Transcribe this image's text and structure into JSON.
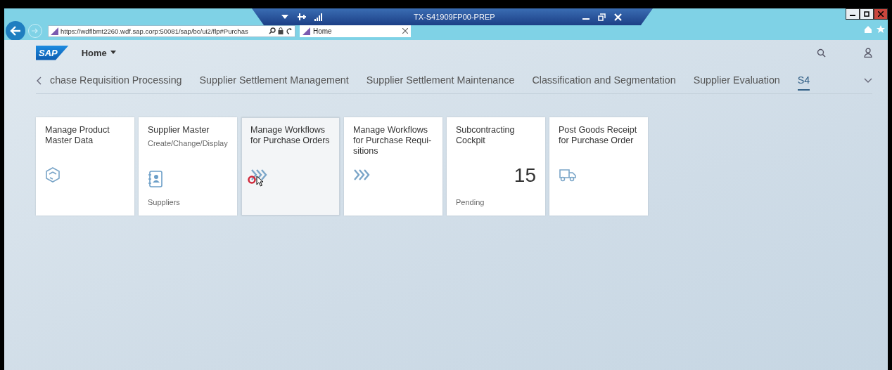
{
  "remote_bar": {
    "title": "TX-S41909FP00-PREP"
  },
  "browser": {
    "url": "https://wdflbmt2260.wdf.sap.corp:50081/sap/bc/ui2/flp#Purchas",
    "tab_title": "Home"
  },
  "shell": {
    "logo": "SAP",
    "title": "Home"
  },
  "groups": [
    {
      "label": "chase Requisition Processing",
      "selected": false
    },
    {
      "label": "Supplier Settlement Management",
      "selected": false
    },
    {
      "label": "Supplier Settlement Maintenance",
      "selected": false
    },
    {
      "label": "Classification and Segmentation",
      "selected": false
    },
    {
      "label": "Supplier Evaluation",
      "selected": false
    },
    {
      "label": "S4",
      "selected": true
    }
  ],
  "tiles": [
    {
      "kind": "icon",
      "title": "Manage Product Master Data",
      "hovered": false
    },
    {
      "kind": "icon",
      "title": "Supplier Master",
      "subtitle": "Create/Change/Display",
      "footer": "Suppliers",
      "hovered": false
    },
    {
      "kind": "icon",
      "title": "Manage Workflows for Purchase Orders",
      "hovered": true
    },
    {
      "kind": "icon",
      "title": "Manage Workflows for Purchase Requi-sitions",
      "hovered": false
    },
    {
      "kind": "numeric",
      "title": "Subcontracting Cockpit",
      "number": "15",
      "footer": "Pending",
      "hovered": false
    },
    {
      "kind": "icon",
      "title": "Post Goods Receipt for Purchase Order",
      "hovered": false
    }
  ]
}
